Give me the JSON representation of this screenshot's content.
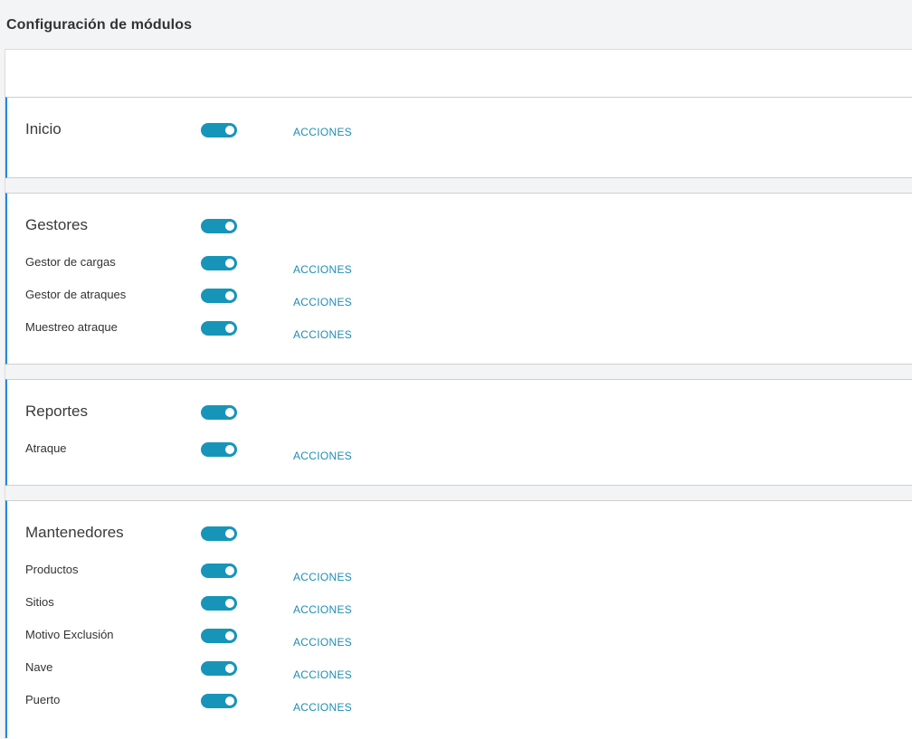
{
  "page": {
    "title": "Configuración de módulos"
  },
  "colors": {
    "accent": "#1795b9",
    "card_border": "#1e88e5",
    "link": "#1b8fb4"
  },
  "modules": {
    "inicio": {
      "label": "Inicio",
      "enabled": true,
      "action": "ACCIONES"
    },
    "gestores": {
      "label": "Gestores",
      "enabled": true,
      "items": [
        {
          "label": "Gestor de cargas",
          "enabled": true,
          "action": "ACCIONES"
        },
        {
          "label": "Gestor de atraques",
          "enabled": true,
          "action": "ACCIONES"
        },
        {
          "label": "Muestreo atraque",
          "enabled": true,
          "action": "ACCIONES"
        }
      ]
    },
    "reportes": {
      "label": "Reportes",
      "enabled": true,
      "items": [
        {
          "label": "Atraque",
          "enabled": true,
          "action": "ACCIONES"
        }
      ]
    },
    "mantenedores": {
      "label": "Mantenedores",
      "enabled": true,
      "items": [
        {
          "label": "Productos",
          "enabled": true,
          "action": "ACCIONES"
        },
        {
          "label": "Sitios",
          "enabled": true,
          "action": "ACCIONES"
        },
        {
          "label": "Motivo Exclusión",
          "enabled": true,
          "action": "ACCIONES"
        },
        {
          "label": "Nave",
          "enabled": true,
          "action": "ACCIONES"
        },
        {
          "label": "Puerto",
          "enabled": true,
          "action": "ACCIONES"
        }
      ]
    }
  }
}
